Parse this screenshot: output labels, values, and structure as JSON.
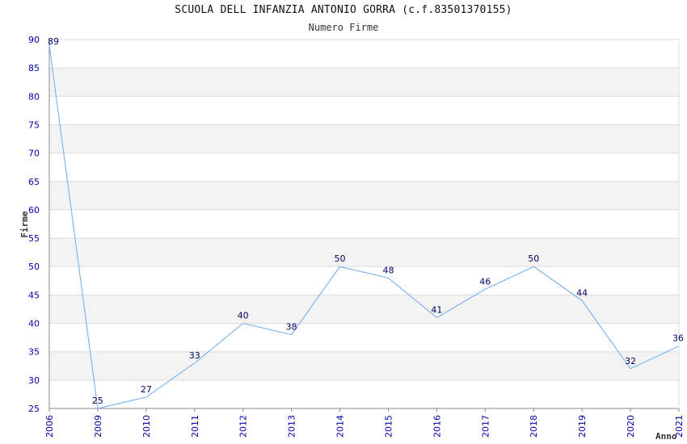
{
  "chart_data": {
    "type": "line",
    "title": "SCUOLA DELL INFANZIA ANTONIO GORRA (c.f.83501370155)",
    "subtitle": "Numero Firme",
    "xlabel": "Anno",
    "ylabel": "Firme",
    "categories": [
      "2006",
      "2009",
      "2010",
      "2011",
      "2012",
      "2013",
      "2014",
      "2015",
      "2016",
      "2017",
      "2018",
      "2019",
      "2020",
      "2021"
    ],
    "series": [
      {
        "values": [
          89,
          25,
          27,
          33,
          40,
          38,
          50,
          48,
          41,
          46,
          50,
          44,
          32,
          36
        ]
      }
    ],
    "ylim": [
      25,
      90
    ],
    "yticks": [
      "25",
      "30",
      "35",
      "40",
      "45",
      "50",
      "55",
      "60",
      "65",
      "70",
      "75",
      "80",
      "85",
      "90"
    ],
    "grid": true,
    "colors": {
      "line": "#6aaaf0",
      "band": "#f3f3f3",
      "tick": "#0000aa"
    }
  }
}
